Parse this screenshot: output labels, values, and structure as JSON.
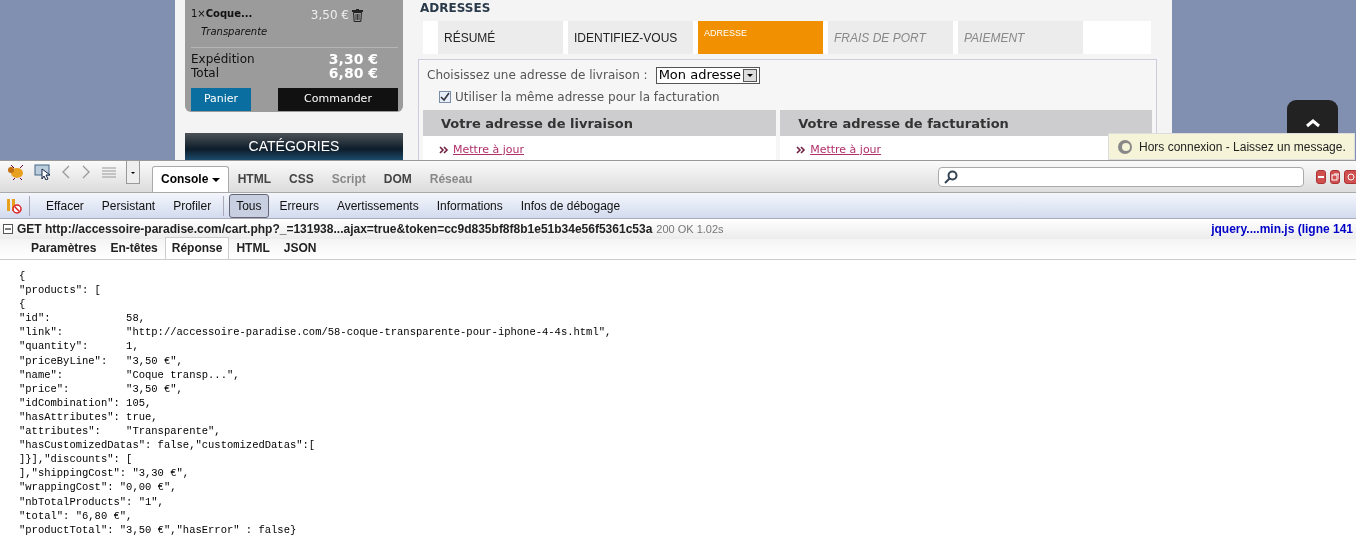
{
  "cart": {
    "item": {
      "quantity": "1×",
      "name": "Coque...",
      "price": "3,50 €",
      "attribute": "Transparente"
    },
    "lines": [
      {
        "label": "Expédition",
        "value": "3,30 €"
      },
      {
        "label": "Total",
        "value": "6,80 €"
      }
    ],
    "buttons": [
      {
        "label": "Panier",
        "kind": "primary"
      },
      {
        "label": "Commander",
        "kind": "dark"
      }
    ]
  },
  "categories": {
    "title": "CATÉGORIES"
  },
  "addresses": {
    "title": "ADRESSES",
    "steps": [
      {
        "label": "RÉSUMÉ",
        "selected": false,
        "disabled": false
      },
      {
        "label": "IDENTIFIEZ-VOUS",
        "selected": false,
        "disabled": false
      },
      {
        "label": "ADRESSE",
        "selected": true,
        "disabled": false
      },
      {
        "label": "FRAIS DE PORT",
        "selected": false,
        "disabled": true
      },
      {
        "label": "PAIEMENT",
        "selected": false,
        "disabled": true
      }
    ],
    "choose_label": "Choisissez une adresse de livraison :",
    "select_value": "Mon adresse",
    "same_address": {
      "label": "Utiliser la même adresse pour la facturation",
      "checked": true
    },
    "panels": [
      {
        "title": "Votre adresse de livraison",
        "link": "Mettre à jour"
      },
      {
        "title": "Votre adresse de facturation",
        "link": "Mettre à jour"
      }
    ]
  },
  "chat_tooltip": "Hors connexion - Laissez un message.",
  "firebug": {
    "tabs": [
      {
        "label": "Console",
        "selected": true,
        "disabled": false
      },
      {
        "label": "HTML",
        "selected": false,
        "disabled": false
      },
      {
        "label": "CSS",
        "selected": false,
        "disabled": false
      },
      {
        "label": "Script",
        "selected": false,
        "disabled": true
      },
      {
        "label": "DOM",
        "selected": false,
        "disabled": false
      },
      {
        "label": "Réseau",
        "selected": false,
        "disabled": true
      }
    ],
    "actions": [
      "Effacer",
      "Persistant",
      "Profiler"
    ],
    "filters": [
      {
        "label": "Tous",
        "selected": true
      },
      {
        "label": "Erreurs",
        "selected": false
      },
      {
        "label": "Avertissements",
        "selected": false
      },
      {
        "label": "Informations",
        "selected": false
      },
      {
        "label": "Infos de débogage",
        "selected": false
      }
    ],
    "request": {
      "expanded": true,
      "text": "GET http://accessoire-paradise.com/cart.php?_=131938...ajax=true&token=cc9d835bf8f8b1e51b34e56f5361c53a",
      "status": "200 OK 1.02s",
      "source": "jquery....min.js (ligne 141"
    },
    "subtabs": [
      {
        "label": "Paramètres",
        "selected": false
      },
      {
        "label": "En-têtes",
        "selected": false
      },
      {
        "label": "Réponse",
        "selected": true
      },
      {
        "label": "HTML",
        "selected": false
      },
      {
        "label": "JSON",
        "selected": false
      }
    ],
    "response_lines": [
      "{",
      "\"products\": [",
      "{",
      "\"id\":            58,",
      "\"link\":          \"http://accessoire-paradise.com/58-coque-transparente-pour-iphone-4-4s.html\",",
      "\"quantity\":      1,",
      "\"priceByLine\":   \"3,50 €\",",
      "\"name\":          \"Coque transp...\",",
      "\"price\":         \"3,50 €\",",
      "\"idCombination\": 105,",
      "\"hasAttributes\": true,",
      "\"attributes\":    \"Transparente\",",
      "\"hasCustomizedDatas\": false,\"customizedDatas\":[",
      "]}],\"discounts\": [",
      "],\"shippingCost\": \"3,30 €\",",
      "\"wrappingCost\": \"0,00 €\",",
      "\"nbTotalProducts\": \"1\",",
      "\"total\": \"6,80 €\",",
      "\"productTotal\": \"3,50 €\",\"hasError\" : false}"
    ]
  }
}
